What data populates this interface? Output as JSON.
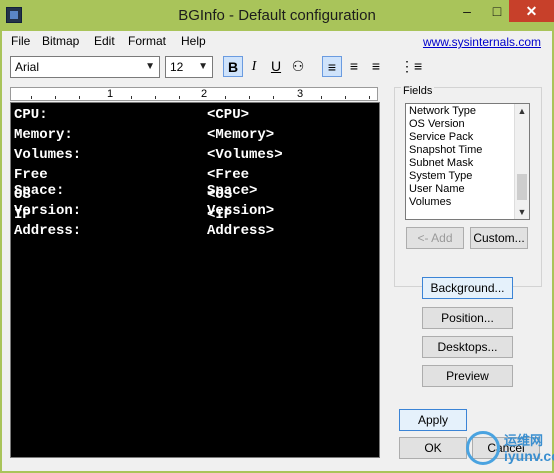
{
  "window": {
    "title": "BGInfo - Default configuration"
  },
  "menu": {
    "items": [
      "File",
      "Bitmap",
      "Edit",
      "Format",
      "Help"
    ],
    "link": "www.sysinternals.com"
  },
  "toolbar": {
    "font": "Arial",
    "size": "12",
    "bold": "B",
    "italic": "I",
    "underline": "U"
  },
  "ruler": {
    "marks": [
      "1",
      "2",
      "3"
    ]
  },
  "editor": {
    "rows": [
      {
        "label": "CPU:",
        "value": "<CPU>"
      },
      {
        "label": "Memory:",
        "value": "<Memory>"
      },
      {
        "label": "Volumes:",
        "value": "<Volumes>"
      },
      {
        "label": "Free Space:",
        "value": "<Free Space>"
      },
      {
        "label": "OS Version:",
        "value": "<OS Version>"
      },
      {
        "label": "IP Address:",
        "value": "<IP Address>"
      }
    ]
  },
  "fields": {
    "title": "Fields",
    "items": [
      "Network Type",
      "OS Version",
      "Service Pack",
      "Snapshot Time",
      "Subnet Mask",
      "System Type",
      "User Name",
      "Volumes"
    ],
    "add_label": "<- Add",
    "custom_label": "Custom..."
  },
  "buttons": {
    "background": "Background...",
    "position": "Position...",
    "desktops": "Desktops...",
    "preview": "Preview",
    "apply": "Apply",
    "ok": "OK",
    "cancel": "Cancel"
  },
  "watermark": {
    "line1": "运维网",
    "line2": "iyunv.com"
  },
  "colors": {
    "titlebar": "#a9c45a",
    "editor_bg": "#000000",
    "close": "#c7402a",
    "link": "#0000cc"
  }
}
